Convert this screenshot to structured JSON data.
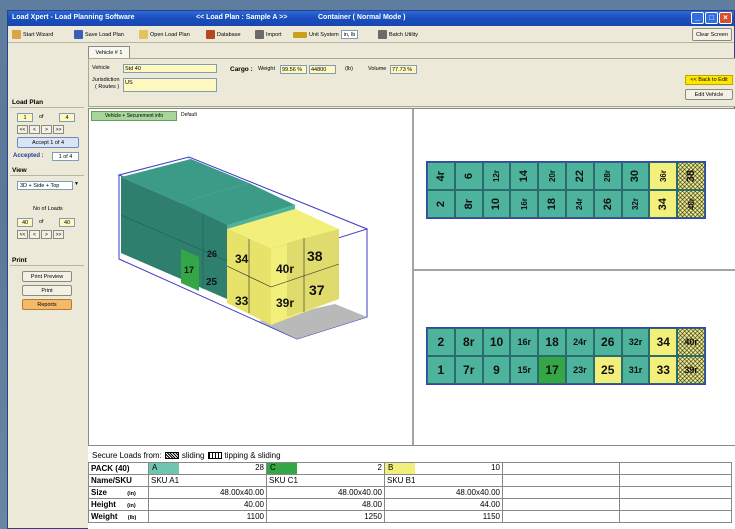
{
  "title_bar": {
    "app_title": "Load Xpert - Load Planning Software",
    "plan_title": "<< Load Plan : Sample A >>",
    "container_title": "Container   ( Normal Mode )"
  },
  "toolbar": {
    "start_wizard": "Start Wizard",
    "save_load_plan": "Save Load Plan",
    "open_load_plan": "Open Load Plan",
    "database": "Database",
    "import": "Import",
    "unit_system": "Unit System",
    "unit_value": "in, lb",
    "batch_utility": "Batch Utility",
    "clear_screen": "Clear Screen"
  },
  "vehicle_panel": {
    "tab": "Vehicle # 1",
    "vehicle_label": "Vehicle",
    "vehicle_value": "Std 40",
    "jurisdiction_label": "Jurisdiction",
    "routes_label": "( Routes )",
    "jurisdiction_value": "US",
    "cargo_label": "Cargo :",
    "weight_label": "Weight",
    "weight_pct": "99.56 %",
    "weight_value": "44800",
    "weight_unit": "(lb)",
    "volume_label": "Volume",
    "volume_pct": "77.73 %",
    "back_to_edit": "<< Back to Edit",
    "edit_vehicle": "Edit Vehicle"
  },
  "left_panel": {
    "load_plan_heading": "Load Plan",
    "plan_current": "1",
    "of_label": "of",
    "plan_total": "4",
    "nav": [
      "<<",
      "<",
      ">",
      ">>"
    ],
    "accept_button": "Accept 1 of 4",
    "accepted_label": "Accepted :",
    "accepted_value": "1 of 4",
    "view_heading": "View",
    "view_select": "3D + Side + Top",
    "no_of_loads_label": "No of Loads",
    "loads_current": "40",
    "loads_of": "of",
    "loads_total": "40",
    "print_heading": "Print",
    "print_preview": "Print Preview",
    "print": "Print",
    "reports": "Reports"
  },
  "view_tabs": {
    "active": "Vehicle + Securement info",
    "inactive": "Default"
  },
  "colors": {
    "teal": "#4db39c",
    "green": "#35a645",
    "yellow": "#f2ef7a",
    "container_outline": "#3c3cc9"
  },
  "top_view": {
    "row1": [
      {
        "label": "4r",
        "color": "teal",
        "rot": true
      },
      {
        "label": "6",
        "color": "teal",
        "rot": true
      },
      {
        "label": "12r",
        "color": "teal",
        "rot": true
      },
      {
        "label": "14",
        "color": "teal",
        "rot": true
      },
      {
        "label": "20r",
        "color": "teal",
        "rot": true
      },
      {
        "label": "22",
        "color": "teal",
        "rot": true
      },
      {
        "label": "28r",
        "color": "teal",
        "rot": true
      },
      {
        "label": "30",
        "color": "teal",
        "rot": true
      },
      {
        "label": "36r",
        "color": "yellow",
        "rot": true
      },
      {
        "label": "38",
        "color": "hatch",
        "rot": true
      }
    ],
    "row2": [
      {
        "label": "2",
        "color": "teal",
        "rot": true
      },
      {
        "label": "8r",
        "color": "teal",
        "rot": true
      },
      {
        "label": "10",
        "color": "teal",
        "rot": true
      },
      {
        "label": "16r",
        "color": "teal",
        "rot": true
      },
      {
        "label": "18",
        "color": "teal",
        "rot": true
      },
      {
        "label": "24r",
        "color": "teal",
        "rot": true
      },
      {
        "label": "26",
        "color": "teal",
        "rot": true
      },
      {
        "label": "32r",
        "color": "teal",
        "rot": true
      },
      {
        "label": "34",
        "color": "yellow",
        "rot": true
      },
      {
        "label": "40r",
        "color": "hatch",
        "rot": true
      }
    ]
  },
  "side_view": {
    "top_row": [
      {
        "label": "2",
        "color": "teal"
      },
      {
        "label": "8r",
        "color": "teal"
      },
      {
        "label": "10",
        "color": "teal"
      },
      {
        "label": "16r",
        "color": "teal"
      },
      {
        "label": "18",
        "color": "teal"
      },
      {
        "label": "24r",
        "color": "teal"
      },
      {
        "label": "26",
        "color": "teal"
      },
      {
        "label": "32r",
        "color": "teal"
      },
      {
        "label": "34",
        "color": "yellow"
      },
      {
        "label": "40r",
        "color": "hatch"
      }
    ],
    "bottom_row": [
      {
        "label": "1",
        "color": "teal"
      },
      {
        "label": "7r",
        "color": "teal"
      },
      {
        "label": "9",
        "color": "teal"
      },
      {
        "label": "15r",
        "color": "teal"
      },
      {
        "label": "17",
        "color": "green"
      },
      {
        "label": "23r",
        "color": "teal"
      },
      {
        "label": "25",
        "color": "yellow"
      },
      {
        "label": "31r",
        "color": "teal"
      },
      {
        "label": "33",
        "color": "yellow"
      },
      {
        "label": "39r",
        "color": "hatch"
      }
    ]
  },
  "view3d": {
    "front_labels": [
      "34",
      "40r",
      "38",
      "33",
      "39r",
      "37",
      "25",
      "17",
      "26"
    ]
  },
  "summary": {
    "legend_prefix": "Secure Loads from:",
    "legend_sliding": "sliding",
    "legend_tipping": "tipping & sliding",
    "rows": {
      "pack_label": "PACK (40)",
      "name_label": "Name/SKU",
      "size_label": "Size",
      "height_label": "Height",
      "weight_label": "Weight",
      "size_unit": "(in)",
      "height_unit": "(in)",
      "weight_unit": "(lb)"
    },
    "columns": [
      {
        "code": "A",
        "count": "28",
        "sku": "SKU A1",
        "size": "48.00x40.00",
        "height": "40.00",
        "weight": "1100",
        "color": "#6fc6b0"
      },
      {
        "code": "C",
        "count": "2",
        "sku": "SKU C1",
        "size": "48.00x40.00",
        "height": "48.00",
        "weight": "1250",
        "color": "#35a645"
      },
      {
        "code": "B",
        "count": "10",
        "sku": "SKU B1",
        "size": "48.00x40.00",
        "height": "44.00",
        "weight": "1150",
        "color": "#f2ef7a"
      }
    ]
  }
}
